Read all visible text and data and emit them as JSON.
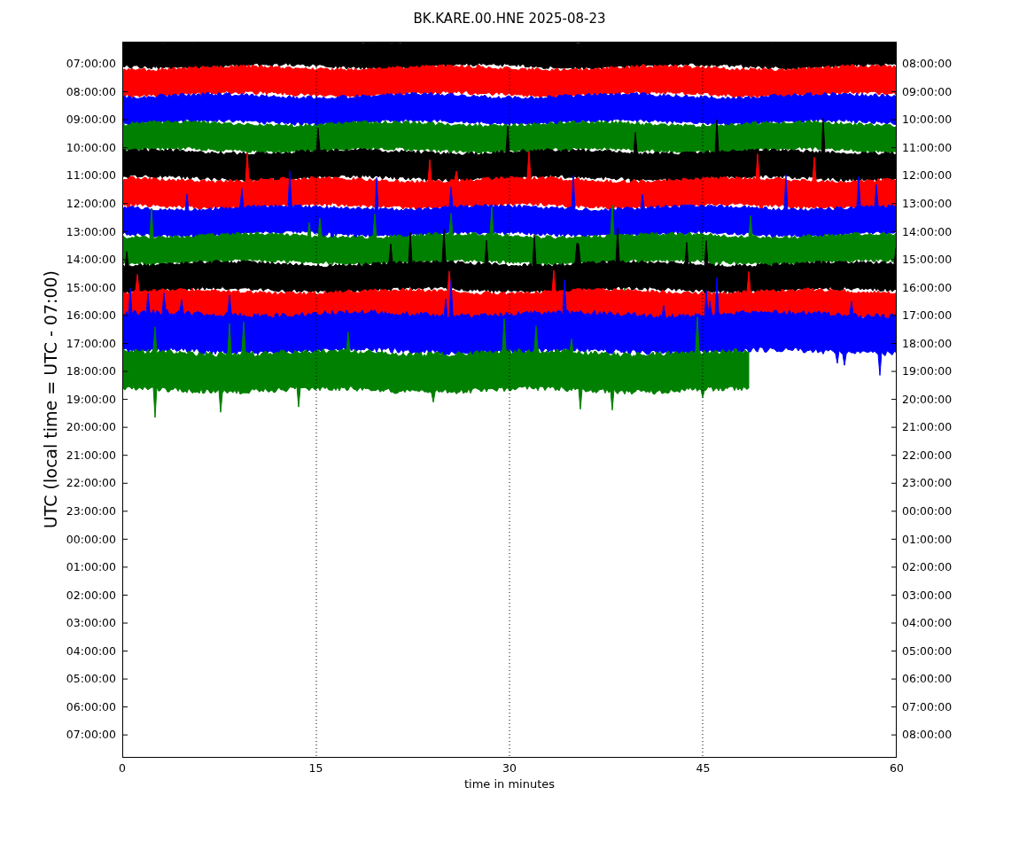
{
  "title": "BK.KARE.00.HNE 2025-08-23",
  "ylabel": "UTC (local time = UTC - 07:00)",
  "xlabel": "time in minutes",
  "left_ticks": [
    "07:00:00",
    "08:00:00",
    "09:00:00",
    "10:00:00",
    "11:00:00",
    "12:00:00",
    "13:00:00",
    "14:00:00",
    "15:00:00",
    "16:00:00",
    "17:00:00",
    "18:00:00",
    "19:00:00",
    "20:00:00",
    "21:00:00",
    "22:00:00",
    "23:00:00",
    "00:00:00",
    "01:00:00",
    "02:00:00",
    "03:00:00",
    "04:00:00",
    "05:00:00",
    "06:00:00",
    "07:00:00"
  ],
  "right_ticks": [
    "08:00:00",
    "09:00:00",
    "10:00:00",
    "11:00:00",
    "12:00:00",
    "13:00:00",
    "14:00:00",
    "15:00:00",
    "16:00:00",
    "17:00:00",
    "18:00:00",
    "19:00:00",
    "20:00:00",
    "21:00:00",
    "22:00:00",
    "23:00:00",
    "00:00:00",
    "01:00:00",
    "02:00:00",
    "03:00:00",
    "04:00:00",
    "05:00:00",
    "06:00:00",
    "07:00:00",
    "08:00:00"
  ],
  "x_ticks": [
    "0",
    "15",
    "30",
    "45",
    "60"
  ],
  "traces": [
    {
      "color": "#000000"
    },
    {
      "color": "#ff0000"
    },
    {
      "color": "#0000ff"
    },
    {
      "color": "#008000"
    },
    {
      "color": "#000000"
    },
    {
      "color": "#ff0000"
    },
    {
      "color": "#0000ff"
    },
    {
      "color": "#008000"
    },
    {
      "color": "#000000"
    },
    {
      "color": "#ff0000"
    },
    {
      "color": "#0000ff"
    },
    {
      "color": "#008000"
    }
  ]
}
